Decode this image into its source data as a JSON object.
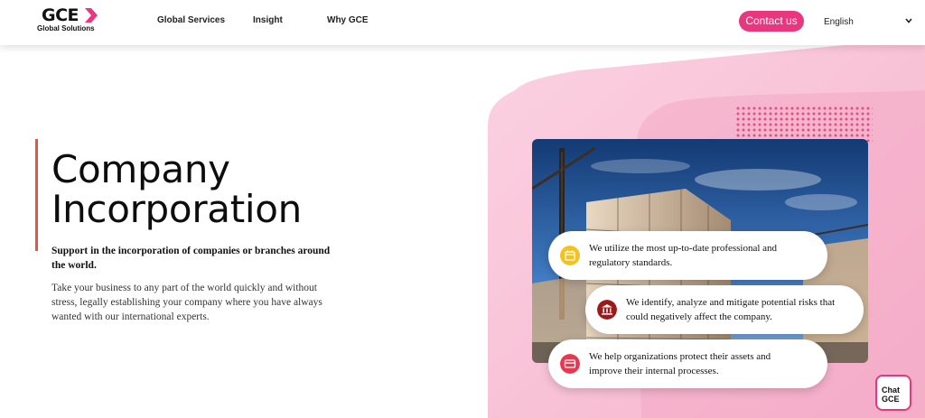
{
  "header": {
    "logo_text": "GCE",
    "logo_sub": "Global Solutions",
    "nav": [
      "Global Services",
      "Insight",
      "Why GCE"
    ],
    "contact_label": "Contact us",
    "language": "English"
  },
  "hero": {
    "title_line1": "Company",
    "title_line2": "Incorporation",
    "subtitle": "Support in the incorporation of companies or branches around the world.",
    "description": "Take your business to any part of the world quickly and without stress, legally establishing your company where you have always wanted with our international experts."
  },
  "features": [
    {
      "icon": "calendar-icon",
      "text_line1": "We utilize the most up-to-date professional and",
      "text_line2": "regulatory standards."
    },
    {
      "icon": "bank-icon",
      "text_line1": "We identify, analyze and mitigate potential risks that",
      "text_line2": "could negatively affect the company."
    },
    {
      "icon": "card-icon",
      "text_line1": "We help organizations protect their assets and",
      "text_line2": "improve their internal processes."
    }
  ],
  "chat": {
    "line1": "Chat",
    "line2": "GCE"
  },
  "colors": {
    "accent": "#e8377f",
    "bar": "#e2563f",
    "pink_bg": "#f7b8cf"
  }
}
